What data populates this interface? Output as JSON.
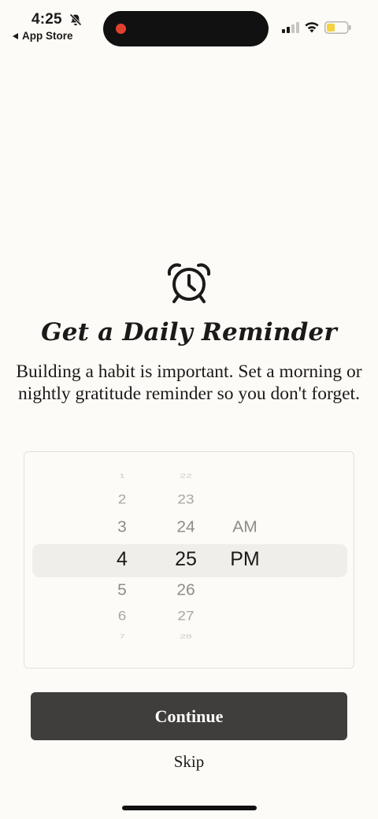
{
  "status_bar": {
    "time": "4:25",
    "back_app": "App Store",
    "battery_color": "#f2d33c",
    "record_color": "#e0412f"
  },
  "icons": {
    "alarm": "alarm-clock-icon",
    "bell_muted": "bell-slash-icon",
    "signal": "cellular-signal-icon",
    "wifi": "wifi-icon",
    "battery": "battery-icon"
  },
  "onboarding": {
    "title": "Get a Daily Reminder",
    "subtitle": "Building a habit is important. Set a morning or nightly gratitude reminder so you don't forget."
  },
  "picker": {
    "hours": [
      "1",
      "2",
      "3",
      "4",
      "5",
      "6",
      "7"
    ],
    "minutes": [
      "22",
      "23",
      "24",
      "25",
      "26",
      "27",
      "28"
    ],
    "periods": [
      "AM",
      "PM"
    ],
    "selected": {
      "hour": "4",
      "minute": "25",
      "period": "PM"
    }
  },
  "actions": {
    "continue_label": "Continue",
    "skip_label": "Skip"
  },
  "colors": {
    "background": "#fdfbf7",
    "button": "#403e3d",
    "highlight": "#f0eeea",
    "text": "#1c1a19"
  }
}
